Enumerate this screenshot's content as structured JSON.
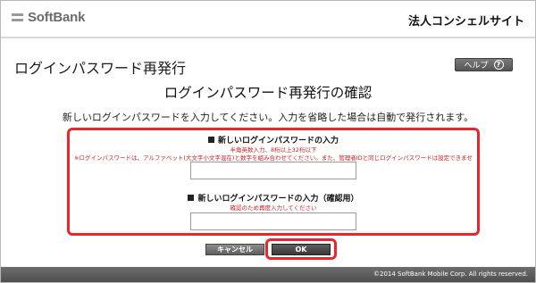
{
  "header": {
    "logo_text": "SoftBank",
    "site_title": "法人コンシェルサイト"
  },
  "page": {
    "title": "ログインパスワード再発行",
    "help_label": "ヘルプ",
    "help_icon": "?",
    "confirm_title": "ログインパスワード再発行の確認",
    "instruction": "新しいログインパスワードを入力してください。入力を省略した場合は自動で発行されます。"
  },
  "form": {
    "new_password": {
      "label": "新しいログインパスワードの入力",
      "hint1": "半角英数入力、8桁以上32桁以下",
      "hint2": "※ログインパスワードは、アルファベット(大文字小文字混在)と数字を組み合わせてください。また、管理者IDと同じログインパスワードは設定できません。",
      "value": ""
    },
    "confirm_password": {
      "label": "新しいログインパスワードの入力（確認用）",
      "hint": "確認のため再度入力してください",
      "value": ""
    }
  },
  "buttons": {
    "cancel": "キャンセル",
    "ok": "OK"
  },
  "footer": {
    "copyright": "©2014 SoftBank Mobile Corp. All rights reserved."
  },
  "colors": {
    "highlight": "#e8262b",
    "hint_text": "#cc1f1f",
    "footer_bg": "#5a5a5a"
  }
}
